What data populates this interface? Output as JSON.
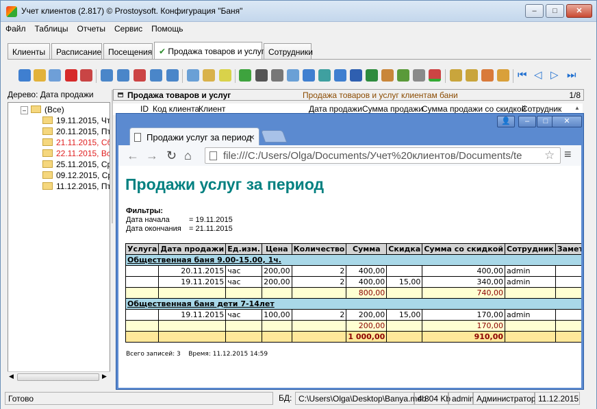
{
  "window": {
    "title": "Учет клиентов (2.817) © Prostoysoft. Конфигурация \"Баня\""
  },
  "menu": [
    "Файл",
    "Таблицы",
    "Отчеты",
    "Сервис",
    "Помощь"
  ],
  "tabs": [
    {
      "label": "Клиенты"
    },
    {
      "label": "Расписание"
    },
    {
      "label": "Посещения"
    },
    {
      "label": "Продажа товаров и услуг",
      "active": true,
      "check": "✔"
    },
    {
      "label": "Сотрудники"
    }
  ],
  "tree": {
    "header": "Дерево: Дата продажи",
    "root": "(Все)",
    "items": [
      {
        "label": "19.11.2015, Чт",
        "color": "#000000"
      },
      {
        "label": "20.11.2015, Пт",
        "color": "#000000"
      },
      {
        "label": "21.11.2015, Сб",
        "color": "#e02020"
      },
      {
        "label": "22.11.2015, Вс",
        "color": "#e02020"
      },
      {
        "label": "25.11.2015, Ср",
        "color": "#000000"
      },
      {
        "label": "09.12.2015, Ср",
        "color": "#000000"
      },
      {
        "label": "11.12.2015, Пт",
        "color": "#000000"
      }
    ]
  },
  "grid": {
    "title": "Продажа товаров и услуг",
    "subtitle": "Продажа товаров и услуг клиентам бани",
    "page": "1/8",
    "columns": [
      "ID",
      "Код клиента",
      "Клиент",
      "Дата продажи",
      "Сумма продажи",
      "Сумма продажи со скидкой",
      "Сотрудник"
    ]
  },
  "browser": {
    "tab_title": "Продажи услуг за период",
    "url": "file:///C:/Users/Olga/Documents/Учет%20клиентов/Documents/te"
  },
  "report": {
    "title": "Продажи услуг за период",
    "filters_label": "Фильтры:",
    "start_label": "Дата начала",
    "start_value": "= 19.11.2015",
    "end_label": "Дата окончания",
    "end_value": "= 21.11.2015",
    "headers": [
      "Услуга",
      "Дата продажи",
      "Ед.изм.",
      "Цена",
      "Количество",
      "Сумма",
      "Скидка",
      "Сумма со скидкой",
      "Сотрудник",
      "Заметки"
    ],
    "groups": [
      {
        "name": "Общественная баня 9.00-15.00, 1ч.",
        "rows": [
          [
            "",
            "20.11.2015",
            "час",
            "200,00",
            "2",
            "400,00",
            "",
            "400,00",
            "admin",
            ""
          ],
          [
            "",
            "19.11.2015",
            "час",
            "200,00",
            "2",
            "400,00",
            "15,00",
            "340,00",
            "admin",
            ""
          ]
        ],
        "subtotal": [
          "",
          "",
          "",
          "",
          "",
          "800,00",
          "",
          "740,00",
          "",
          ""
        ]
      },
      {
        "name": "Общественная баня дети 7-14лет",
        "rows": [
          [
            "",
            "19.11.2015",
            "час",
            "100,00",
            "2",
            "200,00",
            "15,00",
            "170,00",
            "admin",
            ""
          ]
        ],
        "subtotal": [
          "",
          "",
          "",
          "",
          "",
          "200,00",
          "",
          "170,00",
          "",
          ""
        ]
      }
    ],
    "total": [
      "",
      "",
      "",
      "",
      "",
      "1 000,00",
      "",
      "910,00",
      "",
      ""
    ],
    "footer_records": "Всего записей: 3",
    "footer_time": "Время: 11.12.2015 14:59"
  },
  "status": {
    "ready": "Готово",
    "db_label": "БД:",
    "db_path": "C:\\Users\\Olga\\Desktop\\Banya.mdb",
    "size": "4 804 Kb",
    "user": "admin",
    "role": "Администратор",
    "date": "11.12.2015"
  }
}
